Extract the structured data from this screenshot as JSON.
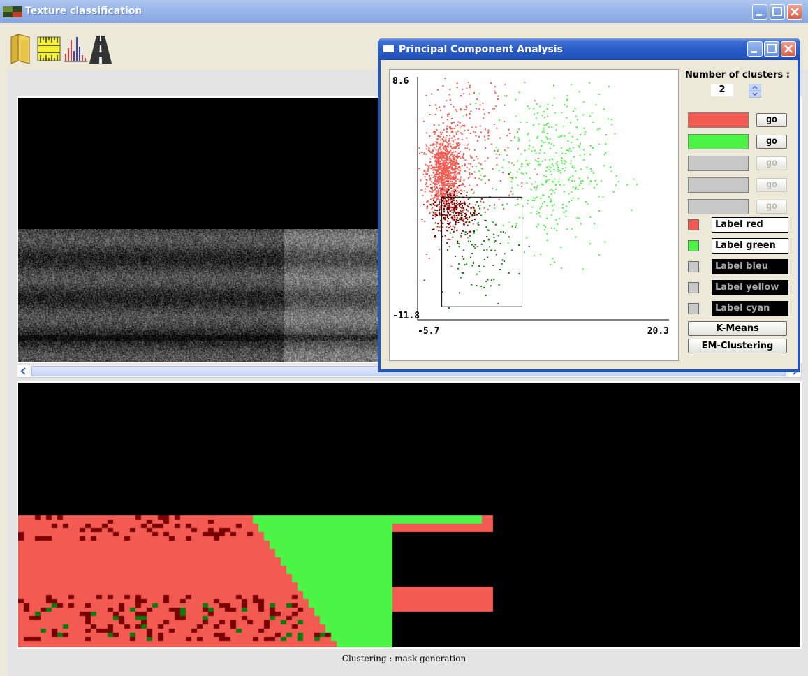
{
  "main_window": {
    "title": "Texture classification",
    "status_text": "Clustering : mask generation"
  },
  "toolbar": {
    "icons": [
      "folder-icon",
      "ruler-icon",
      "histogram-icon",
      "road-icon"
    ]
  },
  "pca_window": {
    "title": "Principal Component Analysis",
    "clusters_label": "Number of clusters :",
    "clusters_value": "2",
    "go_label": "go",
    "cluster_colors": [
      "#f25a52",
      "#4cf545",
      "#c8c8c8",
      "#c8c8c8",
      "#c8c8c8"
    ],
    "go_enabled": [
      true,
      true,
      false,
      false,
      false
    ],
    "labels": [
      {
        "text": "Label red",
        "color": "#f25a52",
        "enabled": true
      },
      {
        "text": "Label green",
        "color": "#4cf545",
        "enabled": true
      },
      {
        "text": "Label bleu",
        "color": "#c8c8c8",
        "enabled": false
      },
      {
        "text": "Label yellow",
        "color": "#c8c8c8",
        "enabled": false
      },
      {
        "text": "Label cyan",
        "color": "#c8c8c8",
        "enabled": false
      }
    ],
    "kmeans_label": "K-Means",
    "em_label": "EM-Clustering"
  },
  "chart_data": {
    "type": "scatter",
    "title": "",
    "xlabel": "",
    "ylabel": "",
    "xlim": [
      -5.7,
      20.3
    ],
    "ylim": [
      -11.8,
      8.6
    ],
    "x_tick_labels": [
      "-5.7",
      "20.3"
    ],
    "y_tick_labels": [
      "8.6",
      "-11.8"
    ],
    "selection_box": {
      "x": [
        -3.2,
        5.1
      ],
      "y": [
        -10.7,
        -1.5
      ]
    },
    "series": [
      {
        "color": "#f25a52",
        "center": [
          -3.0,
          0.6
        ],
        "spread": [
          0.9,
          1.6
        ],
        "count": 900
      },
      {
        "color": "#f25a52",
        "center": [
          -1.0,
          2.8
        ],
        "spread": [
          2.8,
          3.2
        ],
        "count": 320
      },
      {
        "color": "#4cf545",
        "center": [
          8.0,
          1.0
        ],
        "spread": [
          3.0,
          3.4
        ],
        "count": 420
      },
      {
        "color": "#7a0000",
        "center": [
          -2.0,
          -2.6
        ],
        "spread": [
          1.2,
          1.0
        ],
        "count": 260
      },
      {
        "color": "#0d7a0d",
        "center": [
          0.5,
          -5.5
        ],
        "spread": [
          2.0,
          2.2
        ],
        "count": 120
      }
    ]
  },
  "mask_palette": [
    "#000000",
    "#f25a52",
    "#4cf545",
    "#7a0000",
    "#0d7a0d"
  ]
}
